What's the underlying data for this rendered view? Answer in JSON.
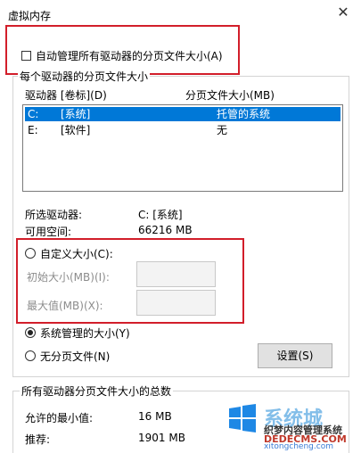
{
  "window": {
    "title": "虚拟内存",
    "close_glyph": "✕"
  },
  "auto_manage": {
    "label": "自动管理所有驱动器的分页文件大小(A)",
    "checked": false
  },
  "group_per_drive": {
    "legend": "每个驱动器的分页文件大小"
  },
  "drive_list": {
    "header_drive": "驱动器 [卷标](D)",
    "header_size": "分页文件大小(MB)",
    "rows": [
      {
        "drive": "C:",
        "label": "[系统]",
        "size": "托管的系统",
        "selected": true
      },
      {
        "drive": "E:",
        "label": "[软件]",
        "size": "无",
        "selected": false
      }
    ]
  },
  "selected_drive": {
    "label": "所选驱动器:",
    "value": "C:  [系统]"
  },
  "free_space": {
    "label": "可用空间:",
    "value": "66216 MB"
  },
  "custom_size": {
    "label": "自定义大小(C):",
    "selected": false
  },
  "initial_size": {
    "label": "初始大小(MB)(I):",
    "value": ""
  },
  "max_size": {
    "label": "最大值(MB)(X):",
    "value": ""
  },
  "system_managed": {
    "label": "系统管理的大小(Y)",
    "selected": true
  },
  "no_paging": {
    "label": "无分页文件(N)",
    "selected": false
  },
  "set_button": {
    "label": "设置(S)"
  },
  "totals": {
    "legend": "所有驱动器分页文件大小的总数",
    "min_label": "允许的最小值:",
    "min_value": "16 MB",
    "recommended_label": "推荐:",
    "recommended_value": "1901 MB"
  },
  "watermark": {
    "brand": "系统城",
    "site": "DEDECMS.COM",
    "site2": "xitongcheng.com",
    "tagline": "织梦内容管理系统"
  },
  "colors": {
    "annotation": "#d21e2a",
    "selection": "#0078d7"
  }
}
